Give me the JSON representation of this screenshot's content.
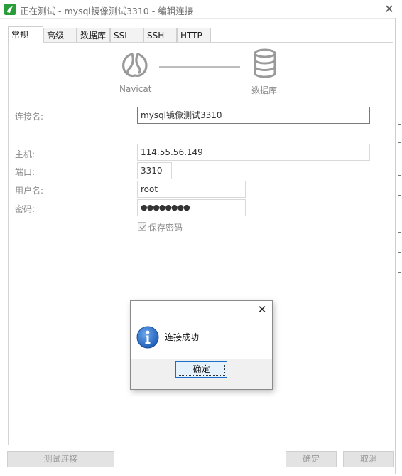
{
  "window": {
    "title": "正在测试 - mysql镜像测试3310 - 编辑连接",
    "close_glyph": "✕"
  },
  "tabs": [
    {
      "label": "常规",
      "active": true
    },
    {
      "label": "高级",
      "active": false
    },
    {
      "label": "数据库",
      "active": false
    },
    {
      "label": "SSL",
      "active": false
    },
    {
      "label": "SSH",
      "active": false
    },
    {
      "label": "HTTP",
      "active": false
    }
  ],
  "diagram": {
    "left_label": "Navicat",
    "right_label": "数据库",
    "left_icon": "navicat-logo-icon",
    "right_icon": "database-icon"
  },
  "form": {
    "connection_name": {
      "label": "连接名:",
      "value": "mysql镜像测试3310"
    },
    "host": {
      "label": "主机:",
      "value": "114.55.56.149"
    },
    "port": {
      "label": "端口:",
      "value": "3310"
    },
    "username": {
      "label": "用户名:",
      "value": "root"
    },
    "password": {
      "label": "密码:",
      "value": "●●●●●●●●"
    },
    "save_password": {
      "label": "保存密码",
      "checked": true
    }
  },
  "buttons": {
    "test_connection": "测试连接",
    "ok": "确定",
    "cancel": "取消"
  },
  "dialog": {
    "message": "连接成功",
    "ok_label": "确定",
    "close_glyph": "✕",
    "icon": "info-icon"
  },
  "colors": {
    "app_icon": "#2a9d3b",
    "info_icon": "#1f5fb8",
    "ok_button_border": "#1a6fc9",
    "ok_button_bg": "#e5f1fb"
  }
}
